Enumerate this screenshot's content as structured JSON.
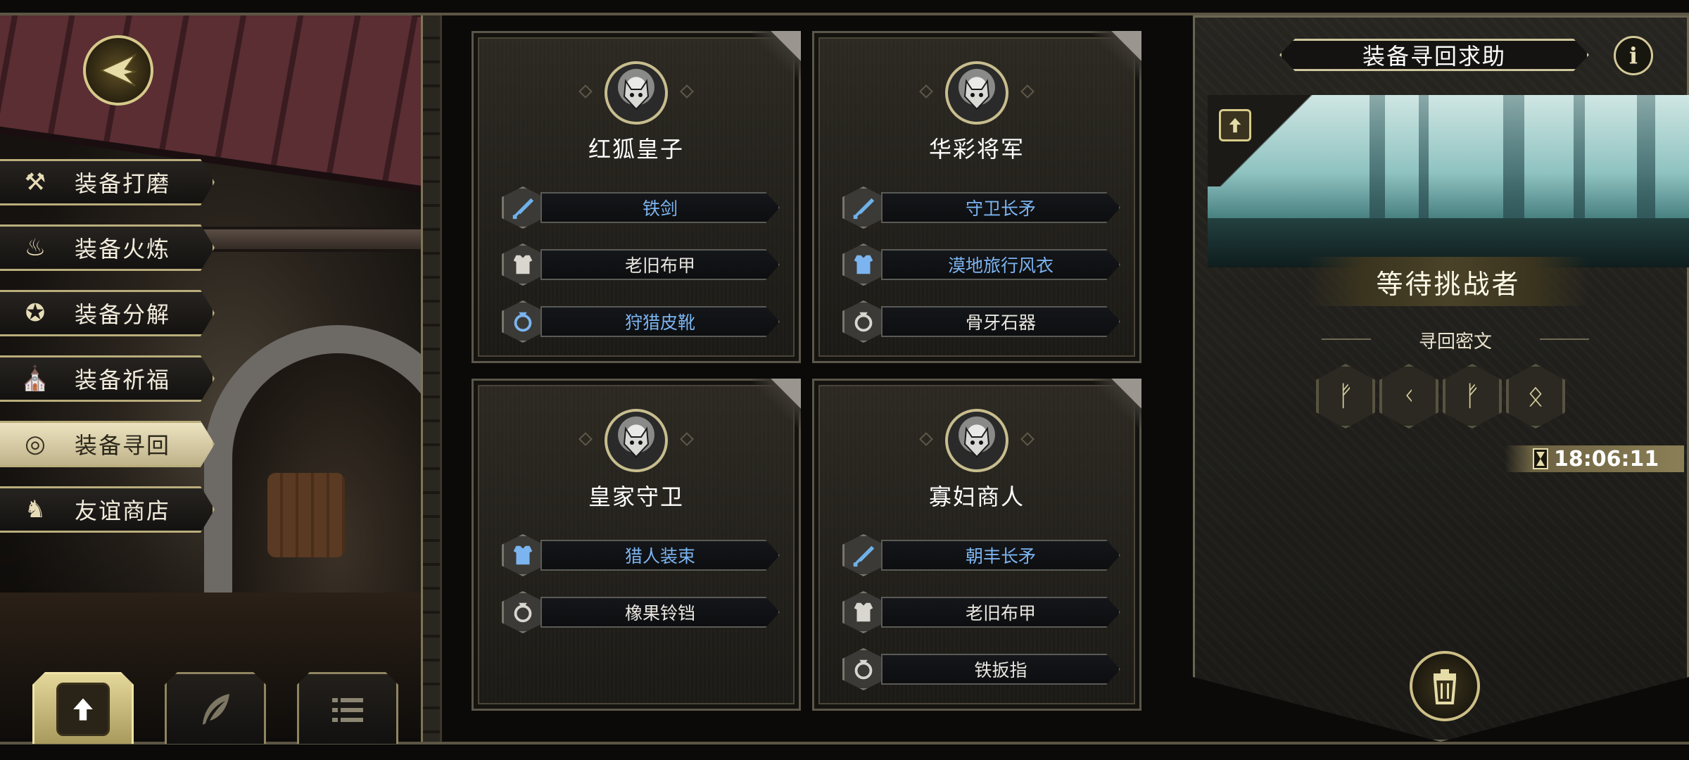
{
  "side_menu": {
    "items": [
      {
        "label": "装备打磨",
        "icon": "hammer-icon",
        "glyph": "⚒"
      },
      {
        "label": "装备火炼",
        "icon": "flame-icon",
        "glyph": "♨"
      },
      {
        "label": "装备分解",
        "icon": "decompose-icon",
        "glyph": "✪"
      },
      {
        "label": "装备祈福",
        "icon": "pray-icon",
        "glyph": "⛪"
      },
      {
        "label": "装备寻回",
        "icon": "target-icon",
        "glyph": "◎",
        "active": true
      },
      {
        "label": "友谊商店",
        "icon": "fox-icon",
        "glyph": "♞"
      }
    ]
  },
  "bottom_tabs": [
    {
      "icon": "upload-icon",
      "active": true
    },
    {
      "icon": "feather-icon",
      "active": false
    },
    {
      "icon": "list-icon",
      "active": false
    }
  ],
  "cards": [
    {
      "name": "红狐皇子",
      "items": [
        {
          "label": "铁剑",
          "type": "sword",
          "rarity": "rare"
        },
        {
          "label": "老旧布甲",
          "type": "armor",
          "rarity": "common"
        },
        {
          "label": "狩猎皮靴",
          "type": "ring",
          "rarity": "rare"
        }
      ]
    },
    {
      "name": "华彩将军",
      "items": [
        {
          "label": "守卫长矛",
          "type": "sword",
          "rarity": "rare"
        },
        {
          "label": "漠地旅行风衣",
          "type": "armor",
          "rarity": "rare"
        },
        {
          "label": "骨牙石器",
          "type": "ring",
          "rarity": "common"
        }
      ]
    },
    {
      "name": "皇家守卫",
      "items": [
        {
          "label": "猎人装束",
          "type": "armor",
          "rarity": "rare"
        },
        {
          "label": "橡果铃铛",
          "type": "ring",
          "rarity": "common"
        }
      ]
    },
    {
      "name": "寡妇商人",
      "items": [
        {
          "label": "朝丰长矛",
          "type": "sword",
          "rarity": "rare"
        },
        {
          "label": "老旧布甲",
          "type": "armor",
          "rarity": "common"
        },
        {
          "label": "铁扳指",
          "type": "ring",
          "rarity": "common"
        }
      ]
    }
  ],
  "right_panel": {
    "title": "装备寻回求助",
    "info_label": "i",
    "status": "等待挑战者",
    "rune_title": "寻回密文",
    "runes": [
      "ᚠ",
      "ᚲ",
      "ᚠ",
      "ᛟ"
    ],
    "timer": "18:06:11"
  },
  "colors": {
    "rare_text": "#7cb4f0",
    "common_text": "#e9e6df",
    "gold_border": "#cfc59e"
  }
}
